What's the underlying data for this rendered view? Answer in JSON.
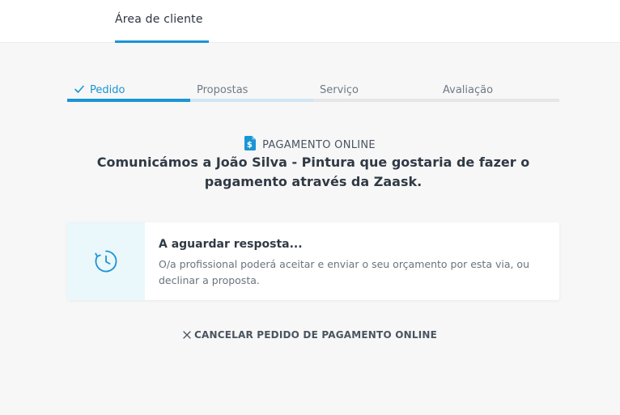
{
  "header": {
    "tab_label": "Área de cliente"
  },
  "steps": [
    {
      "label": "Pedido",
      "state": "done"
    },
    {
      "label": "Propostas",
      "state": "current"
    },
    {
      "label": "Serviço",
      "state": "pending"
    },
    {
      "label": "Avaliação",
      "state": "pending"
    }
  ],
  "payment": {
    "icon": "dollar-document-icon",
    "label": "PAGAMENTO ONLINE",
    "headline": "Comunicámos a João Silva - Pintura que gostaria de fazer o pagamento através da Zaask."
  },
  "status_card": {
    "icon": "clock-icon",
    "title": "A aguardar resposta...",
    "description": "O/a profissional poderá aceitar e enviar o seu orçamento por esta via, ou declinar a proposta."
  },
  "cancel": {
    "icon": "close-icon",
    "label": "CANCELAR PEDIDO DE PAGAMENTO ONLINE"
  },
  "colors": {
    "accent": "#1b95d4",
    "accent_light": "#cfe6f3",
    "background": "#f7f7f7",
    "card_icon_bg": "#eaf7fb"
  }
}
